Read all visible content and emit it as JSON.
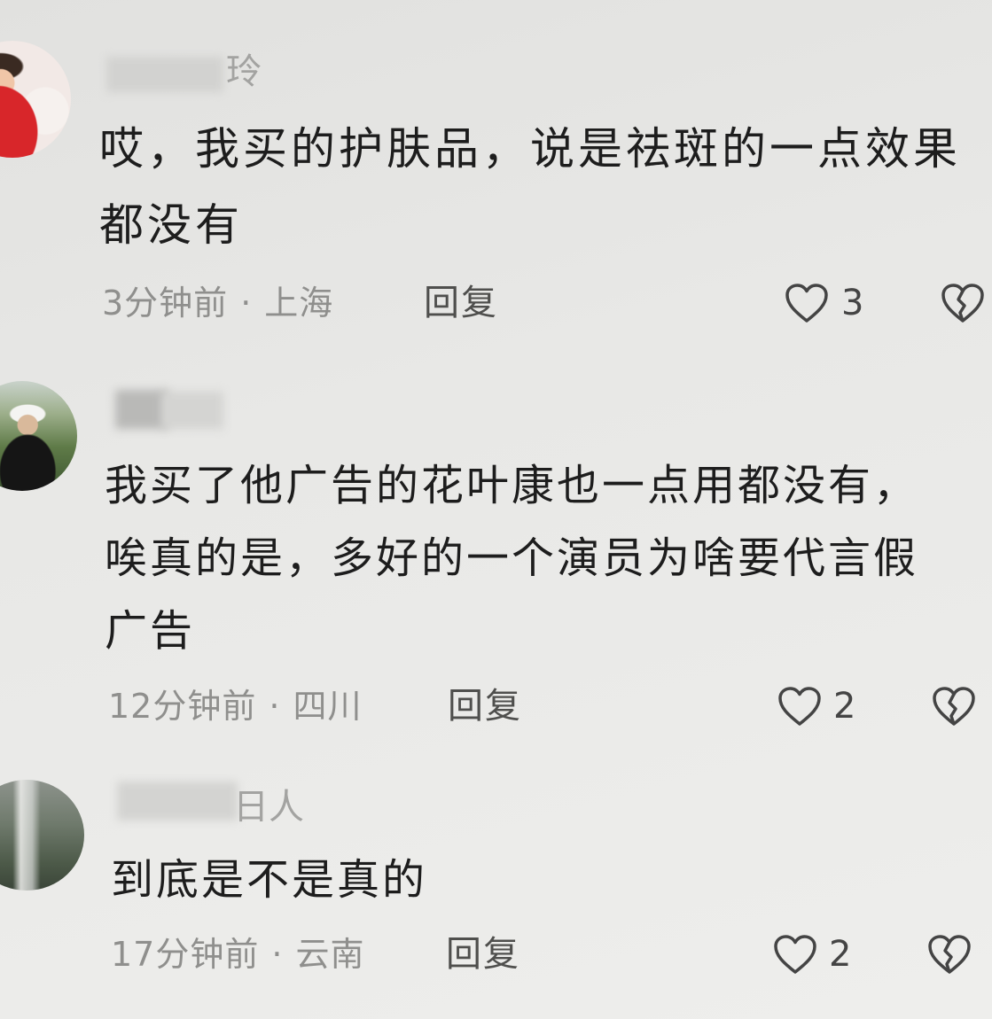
{
  "separator": "·",
  "comments": [
    {
      "username_visible": "玲",
      "text_lines": [
        "哎，我买的护肤品，说是祛斑的一点效果",
        "都没有"
      ],
      "time": "3分钟前",
      "location": "上海",
      "reply_label": "回复",
      "like_count": "3"
    },
    {
      "text_lines": [
        "我买了他广告的花叶康也一点用都没有，",
        "唉真的是，多好的一个演员为啥要代言假",
        "广告"
      ],
      "time": "12分钟前",
      "location": "四川",
      "reply_label": "回复",
      "like_count": "2"
    },
    {
      "username_visible": "日人",
      "text_lines": [
        "到底是不是真的"
      ],
      "time": "17分钟前",
      "location": "云南",
      "reply_label": "回复",
      "like_count": "2"
    }
  ],
  "icons": {
    "like": "heart-outline-icon",
    "dislike": "broken-heart-icon"
  },
  "colors": {
    "background": "#e8e8e6",
    "text": "#1d1d1d",
    "meta": "#8f8f8d",
    "reply": "#4f4f4d",
    "icon": "#444444"
  }
}
